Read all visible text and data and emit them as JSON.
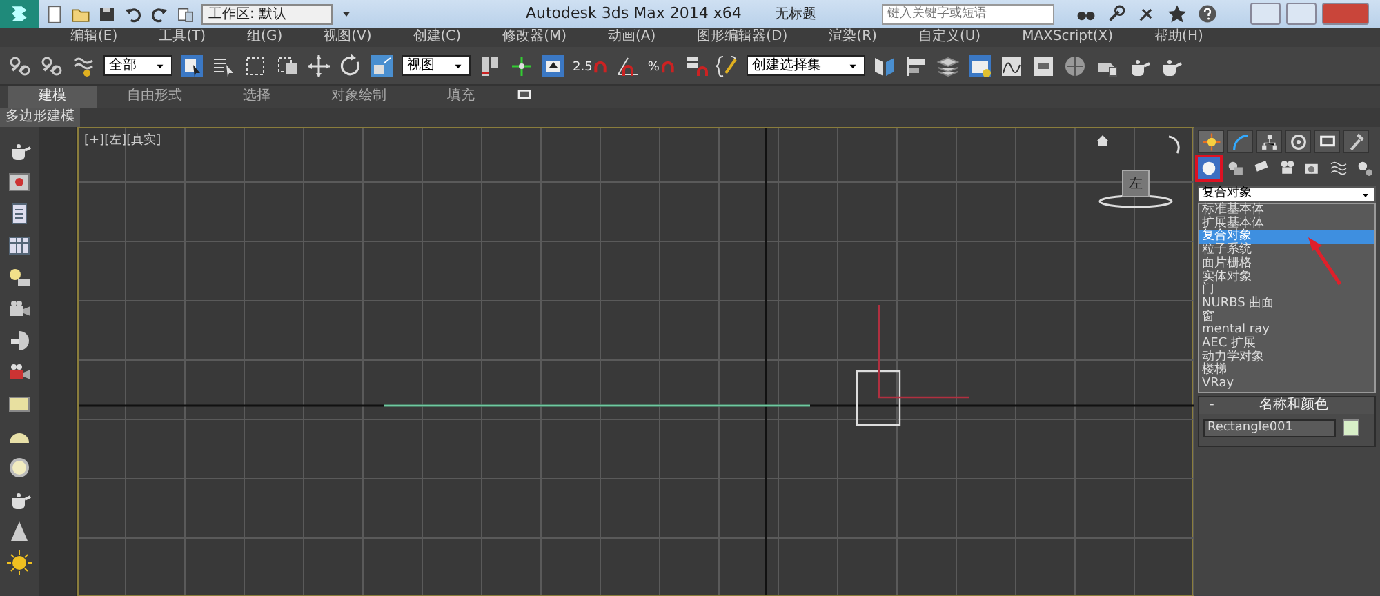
{
  "window": {
    "title": "Autodesk 3ds Max  2014 x64",
    "document": "无标题",
    "workspace": "工作区: 默认",
    "search": {
      "placeholder": "键入关键字或短语"
    }
  },
  "menu": [
    "编辑(E)",
    "工具(T)",
    "组(G)",
    "视图(V)",
    "创建(C)",
    "修改器(M)",
    "动画(A)",
    "图形编辑器(D)",
    "渲染(R)",
    "自定义(U)",
    "MAXScript(X)",
    "帮助(H)"
  ],
  "toolbar": {
    "selection_filter": "全部",
    "coordinate_system": "视图",
    "selection_set": "创建选择集",
    "snap_labels": [
      "2.5",
      "%"
    ]
  },
  "ribbon_tabs": [
    {
      "label": "建模",
      "selected": true
    },
    {
      "label": "自由形式",
      "selected": false
    },
    {
      "label": "选择",
      "selected": false
    },
    {
      "label": "对象绘制",
      "selected": false
    },
    {
      "label": "填充",
      "selected": false
    }
  ],
  "ribbon_panel": "多边形建模",
  "viewport": {
    "label": "[+][左][真实]",
    "viewcube": "左"
  },
  "command_panel": {
    "dropdown": "复合对象",
    "options": [
      {
        "label": "标准基本体",
        "selected": false
      },
      {
        "label": "扩展基本体",
        "selected": false
      },
      {
        "label": "复合对象",
        "selected": true
      },
      {
        "label": "粒子系统",
        "selected": false
      },
      {
        "label": "面片栅格",
        "selected": false
      },
      {
        "label": "实体对象",
        "selected": false
      },
      {
        "label": "门",
        "selected": false
      },
      {
        "label": "NURBS 曲面",
        "selected": false
      },
      {
        "label": "窗",
        "selected": false
      },
      {
        "label": "mental ray",
        "selected": false
      },
      {
        "label": "AEC 扩展",
        "selected": false
      },
      {
        "label": "动力学对象",
        "selected": false
      },
      {
        "label": "楼梯",
        "selected": false
      },
      {
        "label": "VRay",
        "selected": false
      }
    ],
    "rollout": {
      "toggle": "-",
      "title": "名称和颜色",
      "name": "Rectangle001",
      "color": "#d8efc8"
    }
  }
}
